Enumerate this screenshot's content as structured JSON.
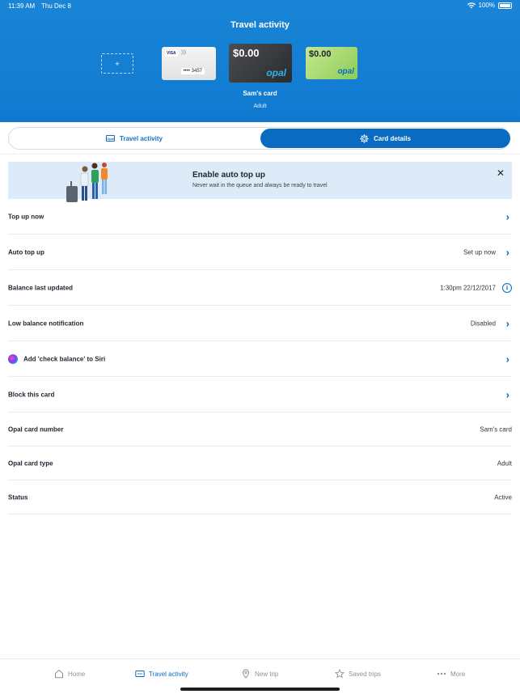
{
  "status_bar": {
    "time": "11:39 AM",
    "date": "Thu Dec 8",
    "battery": "100%"
  },
  "header": {
    "title": "Travel activity",
    "add_card_symbol": "+",
    "cards": {
      "visa": {
        "brand": "VISA",
        "number": "•••• 3457"
      },
      "black": {
        "balance": "$0.00",
        "logo": "opal"
      },
      "green": {
        "balance": "$0.00",
        "logo": "opal"
      }
    },
    "card_name": "Sam's card",
    "card_type": "Adult"
  },
  "tabs": {
    "travel": "Travel activity",
    "card": "Card details",
    "travel_icon_text": "Opal"
  },
  "banner": {
    "title": "Enable auto top up",
    "subtitle": "Never wait in the queue and always be ready to travel",
    "close": "✕"
  },
  "rows": [
    {
      "label": "Top up now",
      "value": ""
    },
    {
      "label": "Auto top up",
      "value": "Set up now"
    },
    {
      "label": "Balance last updated",
      "value": "1:30pm 22/12/2017"
    },
    {
      "label": "Low balance notification",
      "value": "Disabled"
    },
    {
      "label": "Add 'check balance' to Siri",
      "value": ""
    },
    {
      "label": "Block this card",
      "value": ""
    },
    {
      "label": "Opal card number",
      "value": "Sam's card"
    },
    {
      "label": "Opal card type",
      "value": "Adult"
    },
    {
      "label": "Status",
      "value": "Active"
    }
  ],
  "tabbar": {
    "home": "Home",
    "travel": "Travel activity",
    "newtrip": "New trip",
    "saved": "Saved trips",
    "more": "More"
  },
  "colors": {
    "header_blue": "#1a85d6",
    "accent": "#0a6bc2",
    "banner_bg": "#dcebf7"
  }
}
